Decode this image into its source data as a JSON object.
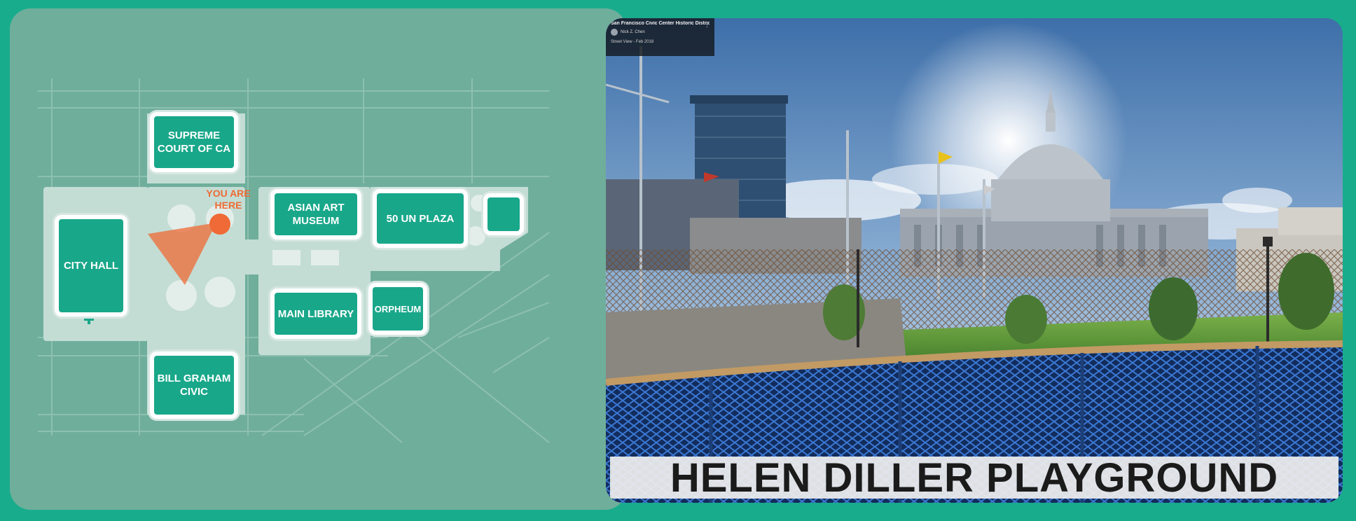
{
  "map": {
    "marker_label": "YOU ARE HERE",
    "buildings": {
      "supreme_court": "SUPREME COURT OF CA",
      "city_hall": "CITY HALL",
      "asian_art_museum": "ASIAN ART MUSEUM",
      "un_plaza": "50 UN PLAZA",
      "main_library": "MAIN LIBRARY",
      "orpheum": "ORPHEUM",
      "bill_graham_civic": "BILL GRAHAM CIVIC"
    },
    "colors": {
      "background": "#6fae9b",
      "building": "#19a78a",
      "marker": "#ef6a36"
    }
  },
  "streetview": {
    "title": "San Francisco Civic Center Historic District",
    "author": "Nick Z. Chen",
    "date": "Street View - Feb 2018",
    "menu_icon": "more-vert-icon"
  },
  "caption": "HELEN DILLER PLAYGROUND",
  "colors": {
    "frame": "#19ac8c"
  }
}
